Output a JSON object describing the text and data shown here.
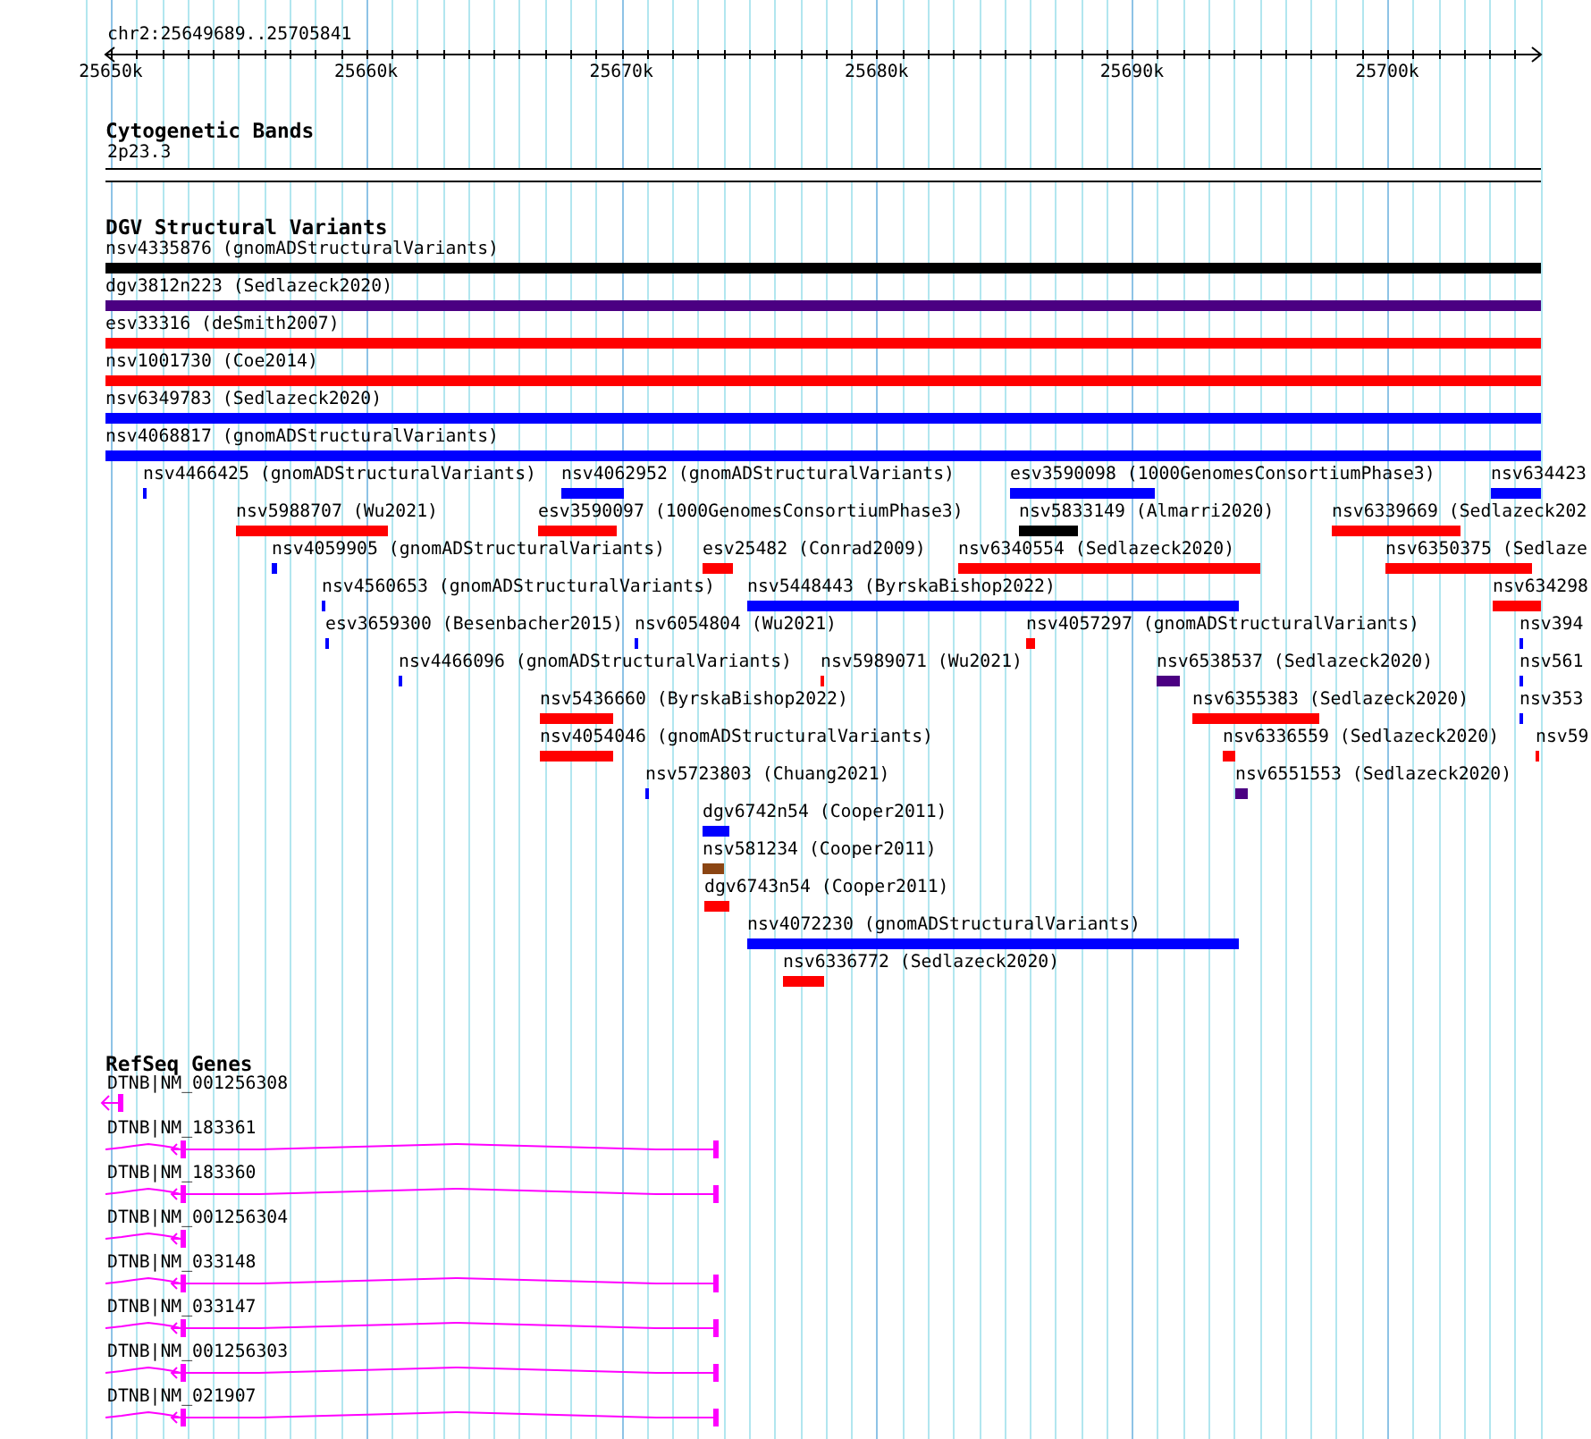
{
  "ruler": {
    "location": "chr2:25649689..25705841",
    "ticks": [
      "25650k",
      "25660k",
      "25670k",
      "25680k",
      "25690k",
      "25700k"
    ]
  },
  "tracks": [
    {
      "kind": "cytoband",
      "title": "Cytogenetic Bands",
      "bands": [
        {
          "name": "2p23.3"
        }
      ]
    },
    {
      "kind": "variants",
      "title": "DGV Structural Variants",
      "features": [
        {
          "label": "nsv4335876 (gnomADStructuralVariants)",
          "color": "#000000"
        },
        {
          "label": "dgv3812n223 (Sedlazeck2020)",
          "color": "#4b0082"
        },
        {
          "label": "esv33316 (deSmith2007)",
          "color": "#ff0000"
        },
        {
          "label": "nsv1001730 (Coe2014)",
          "color": "#ff0000"
        },
        {
          "label": "nsv6349783 (Sedlazeck2020)",
          "color": "#0000ff"
        },
        {
          "label": "nsv4068817 (gnomADStructuralVariants)",
          "color": "#0000ff"
        },
        {
          "label": "nsv4466425 (gnomADStructuralVariants)",
          "color": "#0000ff"
        },
        {
          "label": "nsv4062952 (gnomADStructuralVariants)",
          "color": "#0000ff"
        },
        {
          "label": "esv3590098 (1000GenomesConsortiumPhase3)",
          "color": "#0000ff"
        },
        {
          "label": "nsv634423",
          "color": "#0000ff"
        },
        {
          "label": "nsv5988707 (Wu2021)",
          "color": "#ff0000"
        },
        {
          "label": "esv3590097 (1000GenomesConsortiumPhase3)",
          "color": "#ff0000"
        },
        {
          "label": "nsv5833149 (Almarri2020)",
          "color": "#000000"
        },
        {
          "label": "nsv6339669 (Sedlazeck202",
          "color": "#ff0000"
        },
        {
          "label": "nsv4059905 (gnomADStructuralVariants)",
          "color": "#0000ff"
        },
        {
          "label": "esv25482 (Conrad2009)",
          "color": "#ff0000"
        },
        {
          "label": "nsv6340554 (Sedlazeck2020)",
          "color": "#ff0000"
        },
        {
          "label": "nsv6350375 (Sedlaze",
          "color": "#ff0000"
        },
        {
          "label": "nsv4560653 (gnomADStructuralVariants)",
          "color": "#0000ff"
        },
        {
          "label": "nsv5448443 (ByrskaBishop2022)",
          "color": "#0000ff"
        },
        {
          "label": "nsv634298",
          "color": "#ff0000"
        },
        {
          "label": "esv3659300 (Besenbacher2015)",
          "color": "#0000ff"
        },
        {
          "label": "nsv6054804 (Wu2021)",
          "color": "#0000ff"
        },
        {
          "label": "nsv4057297 (gnomADStructuralVariants)",
          "color": "#ff0000"
        },
        {
          "label": "nsv394",
          "color": "#0000ff"
        },
        {
          "label": "nsv4466096 (gnomADStructuralVariants)",
          "color": "#0000ff"
        },
        {
          "label": "nsv5989071 (Wu2021)",
          "color": "#ff0000"
        },
        {
          "label": "nsv6538537 (Sedlazeck2020)",
          "color": "#4b0082"
        },
        {
          "label": "nsv561",
          "color": "#0000ff"
        },
        {
          "label": "nsv5436660 (ByrskaBishop2022)",
          "color": "#ff0000"
        },
        {
          "label": "nsv6355383 (Sedlazeck2020)",
          "color": "#ff0000"
        },
        {
          "label": "nsv353",
          "color": "#0000ff"
        },
        {
          "label": "nsv4054046 (gnomADStructuralVariants)",
          "color": "#ff0000"
        },
        {
          "label": "nsv6336559 (Sedlazeck2020)",
          "color": "#ff0000"
        },
        {
          "label": "nsv59",
          "color": "#ff0000"
        },
        {
          "label": "nsv5723803 (Chuang2021)",
          "color": "#0000ff"
        },
        {
          "label": "nsv6551553 (Sedlazeck2020)",
          "color": "#4b0082"
        },
        {
          "label": "dgv6742n54 (Cooper2011)",
          "color": "#0000ff"
        },
        {
          "label": "nsv581234 (Cooper2011)",
          "color": "#8b4513"
        },
        {
          "label": "dgv6743n54 (Cooper2011)",
          "color": "#ff0000"
        },
        {
          "label": "nsv4072230 (gnomADStructuralVariants)",
          "color": "#0000ff"
        },
        {
          "label": "nsv6336772 (Sedlazeck2020)",
          "color": "#ff0000"
        }
      ]
    },
    {
      "kind": "genes",
      "title": "RefSeq Genes",
      "transcripts": [
        {
          "label": "DTNB|NM_001256308",
          "kind": "stub"
        },
        {
          "label": "DTNB|NM_183361",
          "kind": "full"
        },
        {
          "label": "DTNB|NM_183360",
          "kind": "full"
        },
        {
          "label": "DTNB|NM_001256304",
          "kind": "partial"
        },
        {
          "label": "DTNB|NM_033148",
          "kind": "full"
        },
        {
          "label": "DTNB|NM_033147",
          "kind": "full"
        },
        {
          "label": "DTNB|NM_001256303",
          "kind": "full"
        },
        {
          "label": "DTNB|NM_021907",
          "kind": "full"
        }
      ]
    }
  ]
}
